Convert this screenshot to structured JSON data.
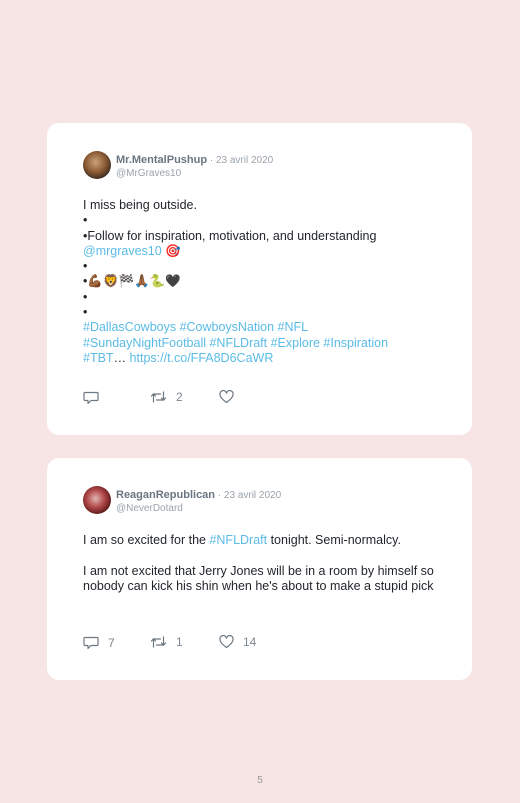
{
  "tweets": [
    {
      "name": "Mr.MentalPushup",
      "date": " · 23 avril 2020",
      "handle": "@MrGraves10",
      "lines": {
        "l1": "I miss being outside.",
        "l2": "•",
        "l3": "•Follow for inspiration, motivation, and understanding",
        "l4_link": "@mrgraves10",
        "l4_emoji": " 🎯",
        "l5": "•",
        "l6": "•💪🏾🦁🏁🙏🏾🐍🖤",
        "l7": "•",
        "l8": "•",
        "h1": "#DallasCowboys #CowboysNation #NFL",
        "h2": "#SundayNightFootball #NFLDraft #Explore #Inspiration",
        "h3a": "#TBT",
        "h3b": "… ",
        "h3c": "https://t.co/FFA8D6CaWR"
      },
      "actions": {
        "reply": "",
        "retweet": "2",
        "like": ""
      }
    },
    {
      "name": "ReaganRepublican",
      "date": " · 23 avril 2020",
      "handle": "@NeverDotard",
      "lines": {
        "p1a": "I am so excited for the ",
        "p1b": "#NFLDraft",
        "p1c": " tonight. Semi-normalcy.",
        "p2": "I am not excited that Jerry Jones will be in a room by himself so nobody can kick his shin when he's about to make a stupid pick"
      },
      "actions": {
        "reply": "7",
        "retweet": "1",
        "like": "14"
      }
    }
  ],
  "page_number": "5",
  "icons": [
    "reply-icon",
    "retweet-icon",
    "like-icon"
  ],
  "colors": {
    "background": "#f7e4e4",
    "card": "#ffffff",
    "link": "#5bbbe6",
    "meta": "#9aa3ab"
  }
}
